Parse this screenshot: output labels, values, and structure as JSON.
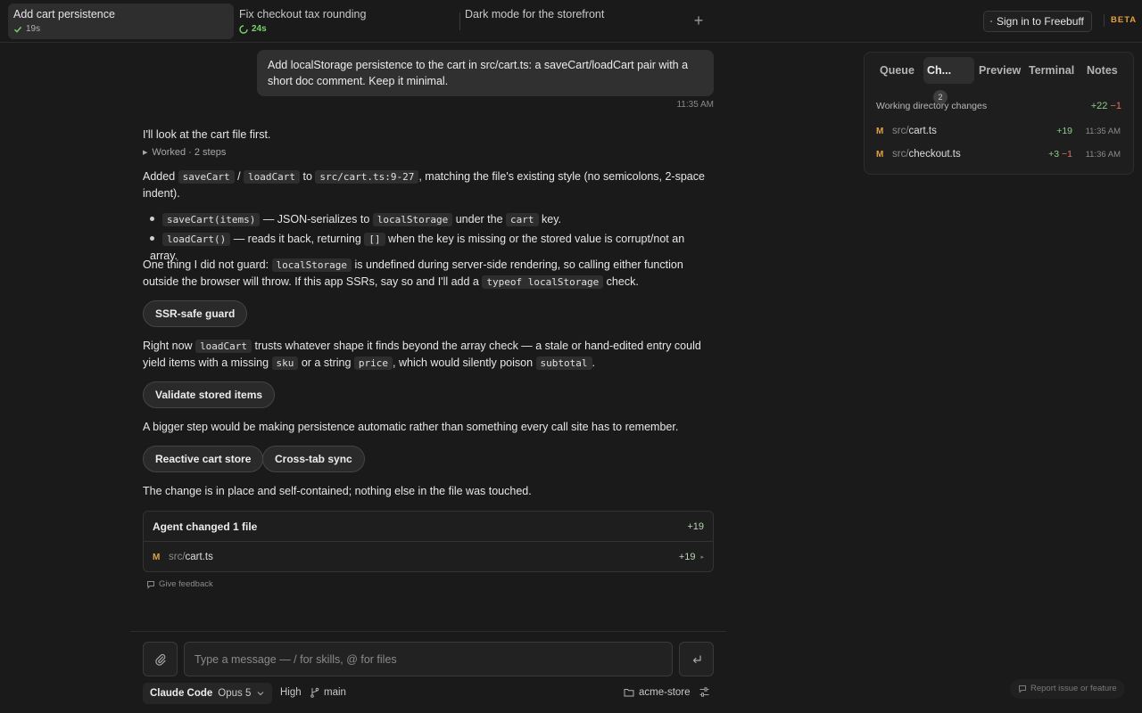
{
  "tabs": [
    {
      "title": "Add cart persistence",
      "status": "19s",
      "status_kind": "done"
    },
    {
      "title": "Fix checkout tax rounding",
      "status": "24s",
      "status_kind": "running"
    },
    {
      "title": "Dark mode for the storefront",
      "status": "",
      "status_kind": "none"
    }
  ],
  "header": {
    "new_tab_icon": "+",
    "sign_in_label": "Sign in to Freebuff",
    "beta_label": "BETA"
  },
  "chat": {
    "user_message": "Add localStorage persistence to the cart in src/cart.ts: a saveCart/loadCart pair with a short doc comment. Keep it minimal.",
    "user_time": "11:35 AM",
    "intro": "I'll look at the cart file first.",
    "worked": "Worked · 2 steps",
    "para1": {
      "a": "Added ",
      "code1": "saveCart",
      "slash": " / ",
      "code2": "loadCart",
      "b": " to ",
      "code3": "src/cart.ts:9-27",
      "c": ", matching the file's existing style (no semicolons, 2-space indent)."
    },
    "bullet1": {
      "code1": "saveCart(items)",
      "a": " — JSON-serializes to ",
      "code2": "localStorage",
      "b": " under the ",
      "code3": "cart",
      "c": " key."
    },
    "bullet2": {
      "code1": "loadCart()",
      "a": " — reads it back, returning ",
      "code2": "[]",
      "b": " when the key is missing or the stored value is corrupt/not an array."
    },
    "para2": {
      "a": "One thing I did not guard: ",
      "code1": "localStorage",
      "b": " is undefined during server-side rendering, so calling either function outside the browser will throw. If this app SSRs, say so and I'll add a ",
      "code2": "typeof localStorage",
      "c": " check."
    },
    "chip1": "SSR-safe guard",
    "para3": {
      "a": "Right now ",
      "code1": "loadCart",
      "b": " trusts whatever shape it finds beyond the array check — a stale or hand-edited entry could yield items with a missing ",
      "code2": "sku",
      "c": " or a string ",
      "code3": "price",
      "d": ", which would silently poison ",
      "code4": "subtotal",
      "e": "."
    },
    "chip2": "Validate stored items",
    "para4": "A bigger step would be making persistence automatic rather than something every call site has to remember.",
    "chip3": "Reactive cart store",
    "chip4": "Cross-tab sync",
    "para5": "The change is in place and self-contained; nothing else in the file was touched.",
    "files_card": {
      "title": "Agent changed 1 file",
      "additions": "+19",
      "file": {
        "status": "M",
        "dir": "src/",
        "name": "cart.ts",
        "additions": "+19"
      }
    },
    "feedback": "Give feedback"
  },
  "composer": {
    "placeholder": "Type a message — / for skills, @ for files",
    "value": "",
    "agent": "Claude Code",
    "model": "Opus 5",
    "effort": "High",
    "branch": "main",
    "project": "acme-store"
  },
  "panel": {
    "tabs": [
      {
        "label": "Queue"
      },
      {
        "label": "Ch...",
        "badge": "2"
      },
      {
        "label": "Preview"
      },
      {
        "label": "Terminal"
      },
      {
        "label": "Notes"
      }
    ],
    "section_title": "Working directory changes",
    "total_plus": "+22",
    "total_minus": "−1",
    "files": [
      {
        "status": "M",
        "dir": "src/",
        "name": "cart.ts",
        "plus": "+19",
        "minus": "",
        "time": "11:35 AM"
      },
      {
        "status": "M",
        "dir": "src/",
        "name": "checkout.ts",
        "plus": "+3",
        "minus": "−1",
        "time": "11:36 AM"
      }
    ]
  },
  "report": "Report issue or feature",
  "colors": {
    "background": "#1a1a1a",
    "accent_beta": "#e8a040",
    "add_green": "#8fcc8a",
    "remove_red": "#e07060",
    "modified": "#e0a040"
  }
}
